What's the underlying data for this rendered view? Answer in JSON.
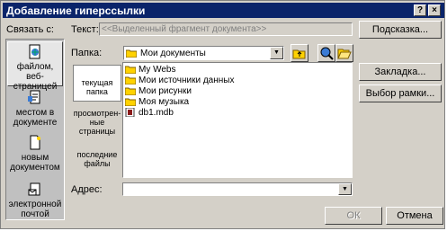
{
  "window": {
    "title": "Добавление гиперссылки",
    "help_glyph": "?",
    "close_glyph": "×"
  },
  "link_to_label": "Связать с:",
  "link_types": [
    {
      "label": "файлом, веб-страницей",
      "icon": "web-page-icon",
      "selected": true
    },
    {
      "label": "местом в документе",
      "icon": "document-place-icon",
      "selected": false
    },
    {
      "label": "новым документом",
      "icon": "new-document-icon",
      "selected": false
    },
    {
      "label": "электронной почтой",
      "icon": "email-icon",
      "selected": false
    }
  ],
  "text_field": {
    "label": "Текст:",
    "value": "<<Выделенный фрагмент документа>>"
  },
  "tooltip_button_label": "Подсказка...",
  "folder": {
    "label": "Папка:",
    "value": "Мои документы"
  },
  "places": [
    {
      "label": "текущая папка",
      "selected": true
    },
    {
      "label": "просмотрен-ные страницы",
      "selected": false
    },
    {
      "label": "последние файлы",
      "selected": false
    }
  ],
  "files": [
    {
      "name": "My Webs",
      "icon": "folder-icon"
    },
    {
      "name": "Мои источники данных",
      "icon": "folder-icon"
    },
    {
      "name": "Мои рисунки",
      "icon": "folder-icon"
    },
    {
      "name": "Моя музыка",
      "icon": "folder-icon"
    },
    {
      "name": "db1.mdb",
      "icon": "database-file-icon"
    }
  ],
  "bookmark_button_label": "Закладка...",
  "frame_button_label": "Выбор рамки...",
  "address": {
    "label": "Адрес:",
    "value": ""
  },
  "ok_label": "ОК",
  "cancel_label": "Отмена",
  "colors": {
    "title_bar": "#0a246a",
    "face": "#d4d0c8"
  }
}
